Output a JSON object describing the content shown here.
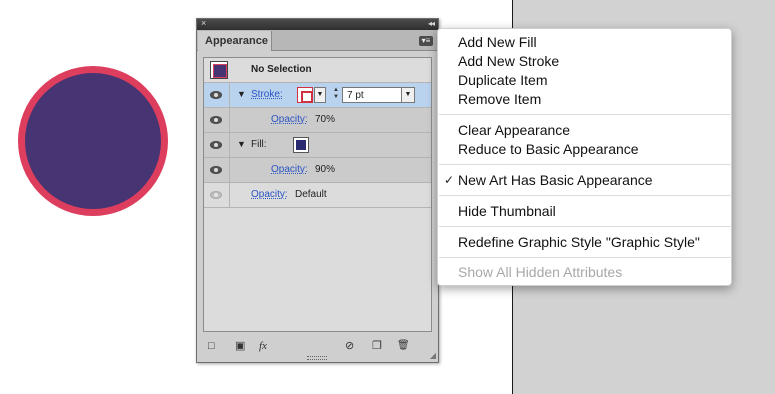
{
  "panel": {
    "tab_label": "Appearance",
    "close_glyph": "×",
    "collapse_glyph": "◂◂",
    "menu_glyph": "▾≡",
    "rows": {
      "header": {
        "label": "No Selection"
      },
      "stroke": {
        "label": "Stroke:",
        "weight": "7 pt"
      },
      "stroke_opacity": {
        "label": "Opacity:",
        "value": "70%"
      },
      "fill": {
        "label": "Fill:"
      },
      "fill_opacity": {
        "label": "Opacity:",
        "value": "90%"
      },
      "object_opacity": {
        "label": "Opacity:",
        "value": "Default"
      }
    },
    "footer": {
      "new_stroke_icon": "□",
      "new_fill_icon": "▣",
      "fx_label": "fx",
      "clear_icon": "⊘",
      "duplicate_icon": "❐",
      "delete_icon": "🗑"
    }
  },
  "menu": {
    "items": [
      {
        "label": "Add New Fill"
      },
      {
        "label": "Add New Stroke"
      },
      {
        "label": "Duplicate Item"
      },
      {
        "label": "Remove Item"
      },
      {
        "label": "Clear Appearance"
      },
      {
        "label": "Reduce to Basic Appearance"
      },
      {
        "label": "New Art Has Basic Appearance",
        "checked": true
      },
      {
        "label": "Hide Thumbnail"
      },
      {
        "label": "Redefine Graphic Style \"Graphic Style\""
      },
      {
        "label": "Show All Hidden Attributes",
        "disabled": true
      }
    ],
    "check_glyph": "✓"
  },
  "colors": {
    "circle_fill": "#473472",
    "circle_stroke": "#dd3e5d"
  }
}
